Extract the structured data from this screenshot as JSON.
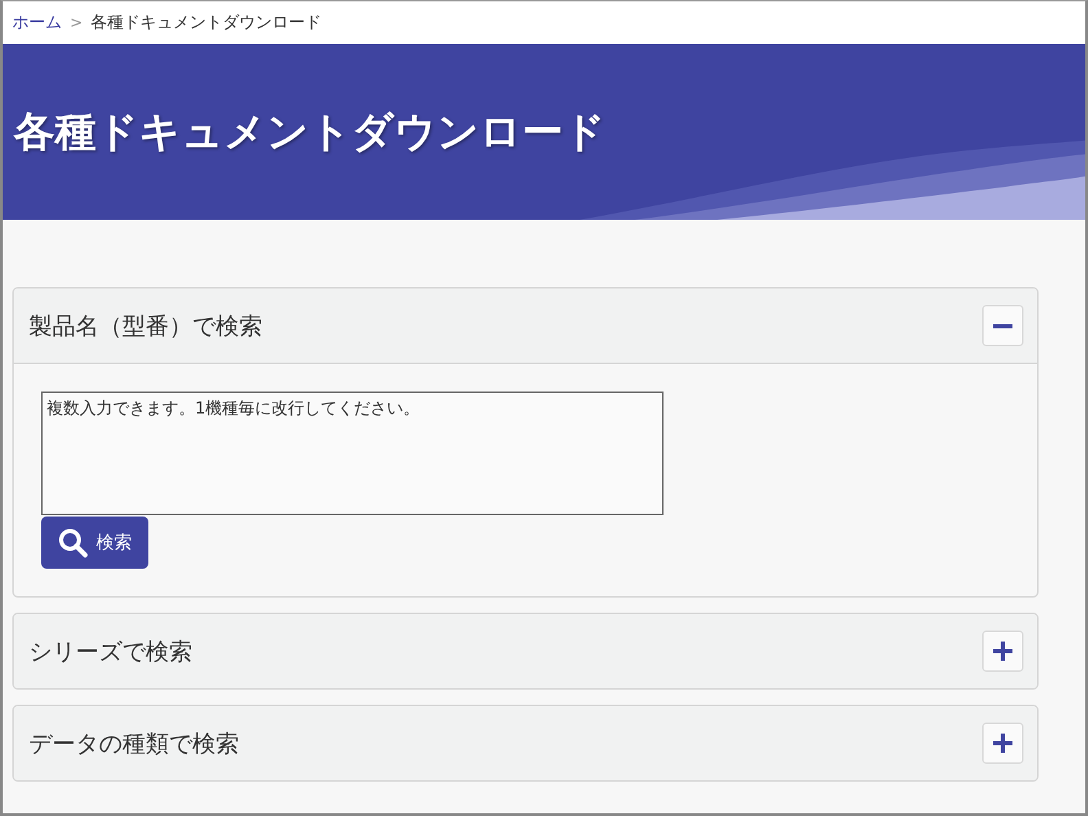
{
  "breadcrumb": [
    {
      "label": "ホーム",
      "kind": "link"
    },
    {
      "label": "各種ドキュメントダウンロード",
      "kind": "current"
    }
  ],
  "breadcrumb_separator": ">",
  "banner": {
    "title": "各種ドキュメントダウンロード"
  },
  "panels": [
    {
      "title": "製品名（型番）で検索",
      "expanded": true,
      "placeholder": "複数入力できます。1機種毎に改行してください。",
      "button": "検索"
    },
    {
      "title": "シリーズで検索",
      "expanded": false
    },
    {
      "title": "データの種類で検索",
      "expanded": false
    }
  ]
}
